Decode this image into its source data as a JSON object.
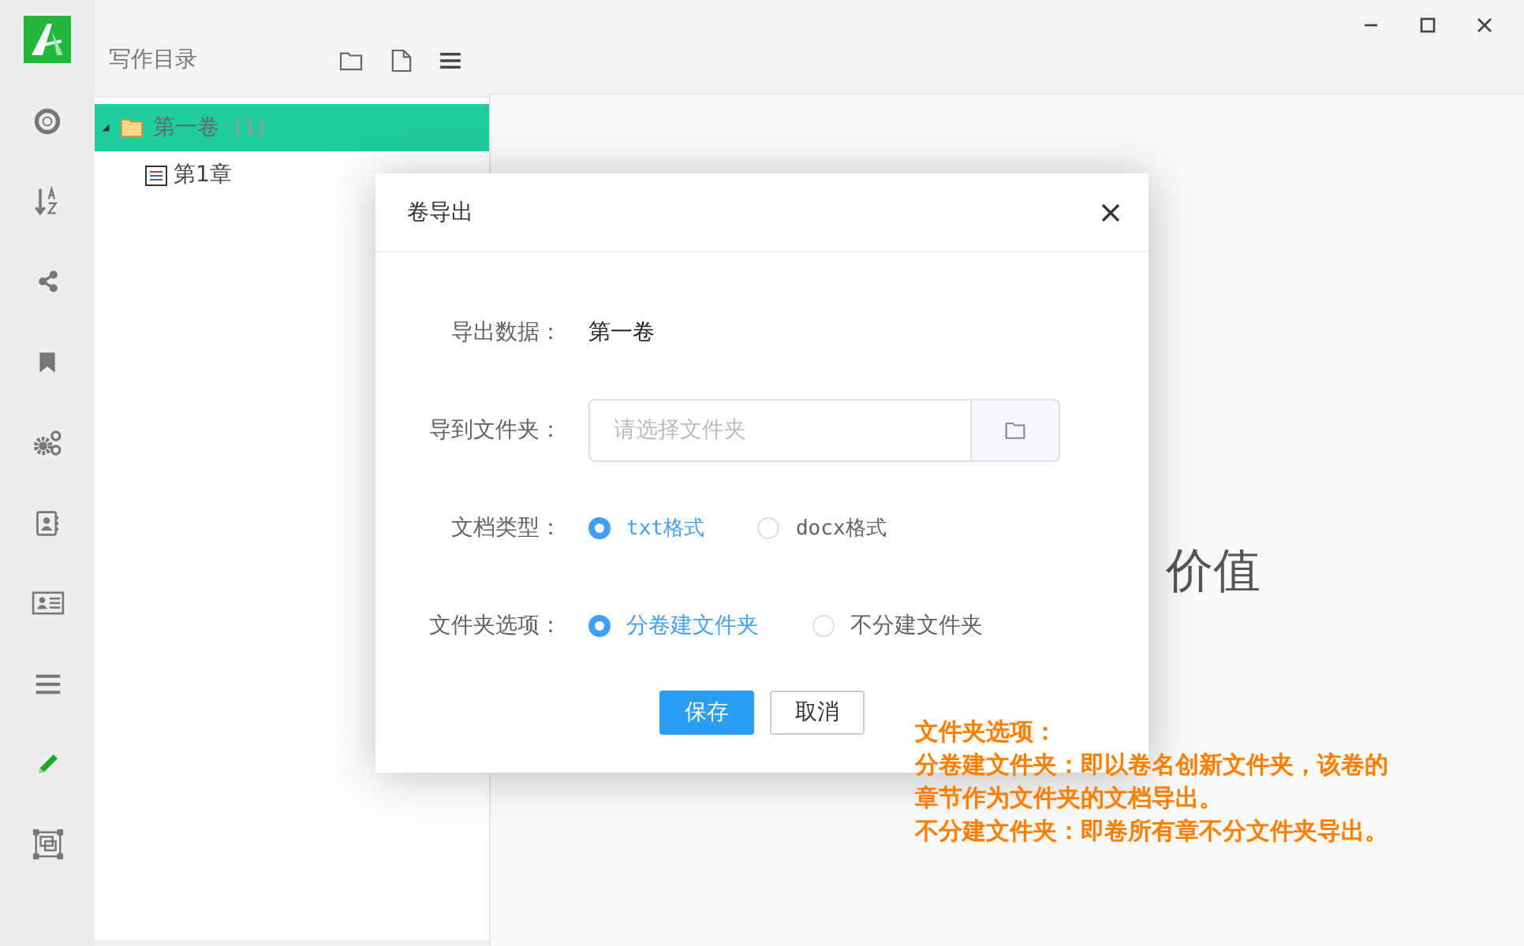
{
  "rail": [
    {
      "kind": "help",
      "selected": false
    },
    {
      "kind": "sort",
      "selected": false
    },
    {
      "kind": "share",
      "selected": false
    },
    {
      "kind": "bookmark",
      "selected": false
    },
    {
      "kind": "settings",
      "selected": false
    },
    {
      "kind": "contacts",
      "selected": false
    },
    {
      "kind": "card",
      "selected": false
    },
    {
      "kind": "menu",
      "selected": false
    },
    {
      "kind": "edit",
      "selected": true
    },
    {
      "kind": "frame",
      "selected": false
    }
  ],
  "sidebar": {
    "title": "写作目录",
    "tree": [
      {
        "label": "第一卷",
        "count": "[1]",
        "expanded": true,
        "selected": true,
        "children": [
          {
            "label": "第1章",
            "selected": false
          }
        ]
      }
    ]
  },
  "main": {
    "partial_text": "价值"
  },
  "dialog": {
    "title": "卷导出",
    "fields": [
      {
        "kind": "text",
        "label": "导出数据：",
        "value": "第一卷"
      },
      {
        "kind": "folder",
        "label": "导到文件夹：",
        "placeholder": "请选择文件夹"
      },
      {
        "kind": "radio",
        "label": "文档类型：",
        "options": [
          {
            "label": "txt格式",
            "selected": true
          },
          {
            "label": "docx格式",
            "selected": false
          }
        ]
      },
      {
        "kind": "radio",
        "label": "文件夹选项：",
        "options": [
          {
            "label": "分卷建文件夹",
            "selected": true
          },
          {
            "label": "不分建文件夹",
            "selected": false
          }
        ]
      }
    ],
    "buttons": [
      {
        "label": "保存",
        "kind": "primary"
      },
      {
        "label": "取消",
        "kind": "default"
      }
    ]
  },
  "annotation": {
    "lines": [
      "文件夹选项：",
      "分卷建文件夹：即以卷名创新文件夹，该卷的",
      "章节作为文件夹的文档导出。",
      "不分建文件夹：即卷所有章不分文件夹导出。"
    ]
  }
}
